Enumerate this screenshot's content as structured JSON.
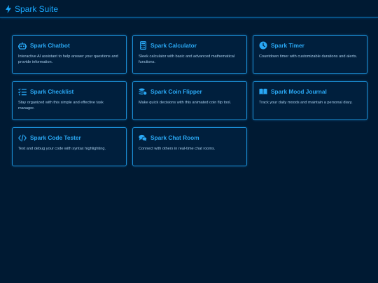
{
  "app": {
    "title": "Spark Suite",
    "accent_color": "#19a9ff",
    "background_color": "#001a33"
  },
  "cards": [
    {
      "icon": "robot-icon",
      "title": "Spark Chatbot",
      "description": "Interactive AI assistant to help answer your questions and provide information."
    },
    {
      "icon": "calculator-icon",
      "title": "Spark Calculator",
      "description": "Sleek calculator with basic and advanced mathematical functions."
    },
    {
      "icon": "clock-icon",
      "title": "Spark Timer",
      "description": "Countdown timer with customizable durations and alerts."
    },
    {
      "icon": "checklist-icon",
      "title": "Spark Checklist",
      "description": "Stay organized with this simple and effective task manager."
    },
    {
      "icon": "coins-icon",
      "title": "Spark Coin Flipper",
      "description": "Make quick decisions with this animated coin flip tool."
    },
    {
      "icon": "open-book-icon",
      "title": "Spark Mood Journal",
      "description": "Track your daily moods and maintain a personal diary."
    },
    {
      "icon": "code-icon",
      "title": "Spark Code Tester",
      "description": "Test and debug your code with syntax highlighting."
    },
    {
      "icon": "chat-bubbles-icon",
      "title": "Spark Chat Room",
      "description": "Connect with others in real-time chat rooms."
    }
  ]
}
